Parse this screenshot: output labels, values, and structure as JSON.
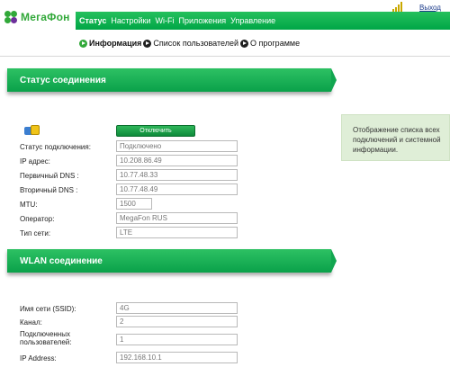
{
  "header": {
    "brand": "МегаФон",
    "logout": "Выход",
    "nav": [
      {
        "label": "Статус",
        "active": true
      },
      {
        "label": "Настройки"
      },
      {
        "label": "Wi-Fi"
      },
      {
        "label": "Приложения"
      },
      {
        "label": "Управление"
      }
    ],
    "subnav": [
      {
        "label": "Информация",
        "active": true
      },
      {
        "label": "Список пользователей"
      },
      {
        "label": "О программе"
      }
    ]
  },
  "status_section": {
    "title": "Статус соединения",
    "disconnect_label": "Отключить",
    "rows": [
      {
        "label": "Статус подключения:",
        "value": "Подключено"
      },
      {
        "label": "IP адрес:",
        "value": "10.208.86.49"
      },
      {
        "label": "Первичный DNS :",
        "value": "10.77.48.33"
      },
      {
        "label": "Вторичный DNS :",
        "value": "10.77.48.49"
      },
      {
        "label": "MTU:",
        "value": "1500"
      },
      {
        "label": "Оператор:",
        "value": "MegaFon RUS"
      },
      {
        "label": "Тип сети:",
        "value": "LTE"
      }
    ]
  },
  "wlan_section": {
    "title": "WLAN соединение",
    "rows": [
      {
        "label": "Имя сети (SSID):",
        "value": "4G"
      },
      {
        "label": "Канал:",
        "value": "2"
      },
      {
        "label": "Подключенных пользователей:",
        "value": "1"
      },
      {
        "label": "IP Address:",
        "value": "192.168.10.1"
      }
    ]
  },
  "help_text": "Отображение списка всех подключений и системной информации.",
  "colors": {
    "brand_green": "#31a839",
    "nav_green": "#00a646",
    "info_bg": "#dfeed7"
  },
  "icons": [
    "megafon-logo-icon",
    "signal-icon",
    "arrow-icon",
    "connection-icon"
  ]
}
